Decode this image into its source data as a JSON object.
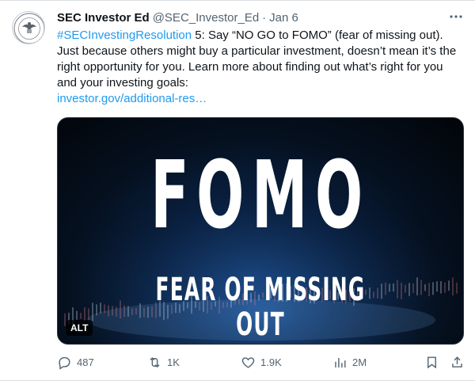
{
  "tweet": {
    "author_name": "SEC Investor Ed",
    "handle": "@SEC_Investor_Ed",
    "separator": "·",
    "date": "Jan 6",
    "more_icon": "more-icon",
    "text": {
      "hashtag": "#SECInvestingResolution",
      "body": " 5: Say “NO GO to FOMO” (fear of missing out). Just because others might buy a particular investment, doesn’t mean it’s the right opportunity for you. Learn more about finding out what’s right for you and your investing goals:",
      "link": "investor.gov/additional-res…"
    },
    "media": {
      "headline": "FOMO",
      "subline": "FEAR OF MISSING OUT",
      "alt_badge": "ALT"
    },
    "actions": {
      "replies": "487",
      "reposts": "1K",
      "likes": "1.9K",
      "views": "2M"
    }
  }
}
